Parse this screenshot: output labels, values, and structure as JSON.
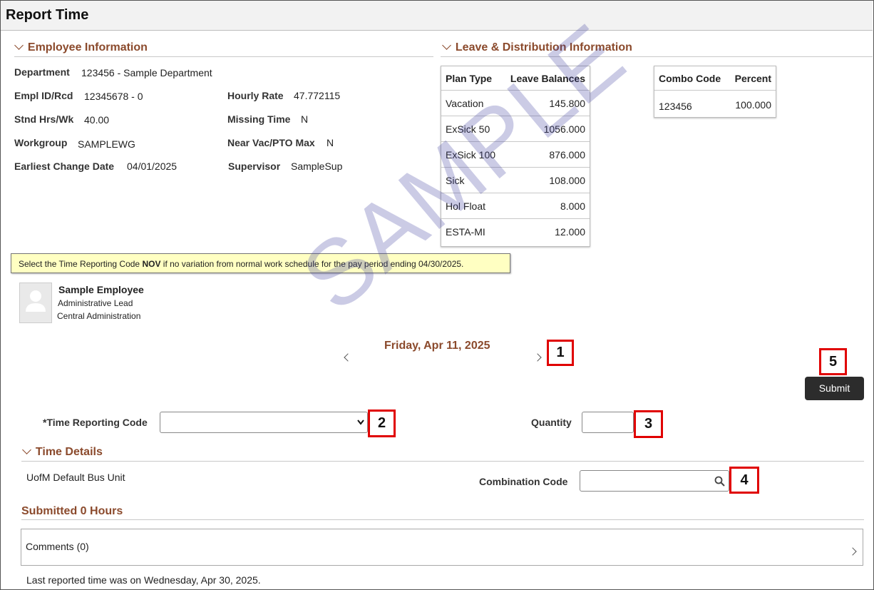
{
  "page": {
    "title": "Report Time"
  },
  "employee_info": {
    "heading": "Employee Information",
    "department_label": "Department",
    "department_value": "123456 - Sample Department",
    "empl_label": "Empl ID/Rcd",
    "empl_value": "12345678 - 0",
    "stnd_label": "Stnd Hrs/Wk",
    "stnd_value": "40.00",
    "workgroup_label": "Workgroup",
    "workgroup_value": "SAMPLEWG",
    "earliest_label": "Earliest Change Date",
    "earliest_value": "04/01/2025",
    "hourly_label": "Hourly Rate",
    "hourly_value": "47.772115",
    "missing_label": "Missing Time",
    "missing_value": "N",
    "nearvac_label": "Near Vac/PTO Max",
    "nearvac_value": "N",
    "supervisor_label": "Supervisor",
    "supervisor_value": "SampleSup"
  },
  "leave": {
    "heading": "Leave & Distribution Information",
    "plan_header": "Plan Type",
    "balance_header": "Leave Balances",
    "rows": [
      {
        "plan": "Vacation",
        "balance": "145.800"
      },
      {
        "plan": "ExSick 50",
        "balance": "1056.000"
      },
      {
        "plan": "ExSick 100",
        "balance": "876.000"
      },
      {
        "plan": "Sick",
        "balance": "108.000"
      },
      {
        "plan": "Hol Float",
        "balance": "8.000"
      },
      {
        "plan": "ESTA-MI",
        "balance": "12.000"
      }
    ],
    "combo_header": "Combo Code",
    "percent_header": "Percent",
    "combo_value": "123456",
    "percent_value": "100.000"
  },
  "notice": {
    "before": "Select the Time Reporting Code ",
    "code": "NOV",
    "after": " if no variation from normal work schedule for the pay period ending 04/30/2025."
  },
  "person": {
    "name": "Sample Employee",
    "title": "Administrative Lead",
    "dept": "Central Administration"
  },
  "date_nav": {
    "date": "Friday, Apr 11, 2025"
  },
  "watermark": "SAMPLE",
  "callouts": [
    "1",
    "2",
    "3",
    "4",
    "5"
  ],
  "form": {
    "submit_label": "Submit",
    "trc_label": "*Time Reporting Code",
    "trc_value": "",
    "quantity_label": "Quantity",
    "quantity_value": ""
  },
  "time_details": {
    "heading": "Time Details",
    "bus_unit": "UofM Default Bus Unit",
    "combo_label": "Combination Code",
    "combo_value": ""
  },
  "submitted": {
    "heading": "Submitted 0 Hours"
  },
  "comments": {
    "label": "Comments (0)"
  },
  "footer": {
    "last_reported": "Last reported time was on Wednesday, Apr 30, 2025."
  }
}
